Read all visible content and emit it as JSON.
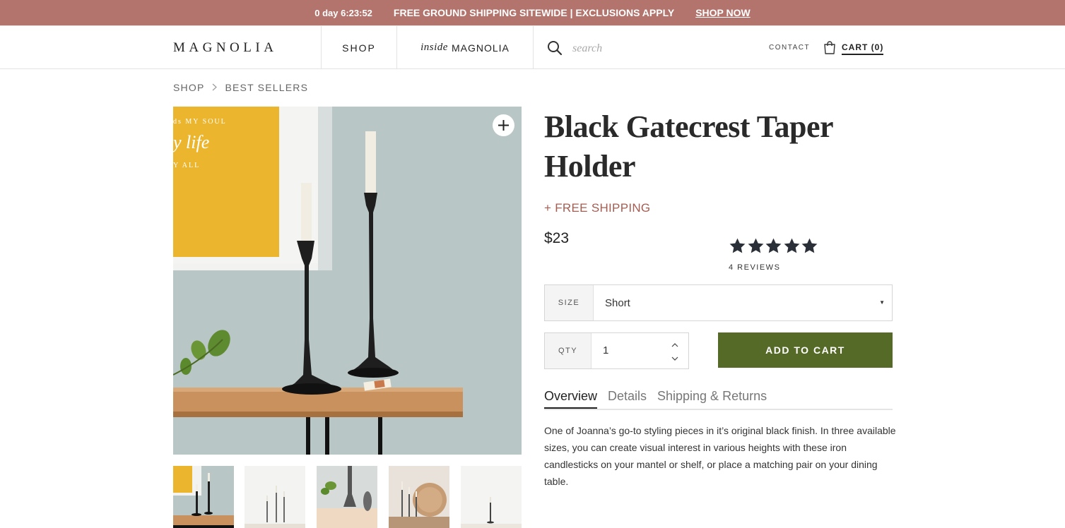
{
  "promo": {
    "timer": "0 day 6:23:52",
    "message": "FREE GROUND SHIPPING SITEWIDE | EXCLUSIONS APPLY",
    "cta": "SHOP NOW",
    "color": "#b2746c"
  },
  "header": {
    "logo": "MAGNOLIA",
    "nav_shop": "SHOP",
    "nav_inside_prefix": "inside",
    "nav_inside_brand": "MAGNOLIA",
    "search_placeholder": "search",
    "contact": "CONTACT",
    "cart": "CART (0)"
  },
  "breadcrumb": [
    "SHOP",
    "BEST SELLERS"
  ],
  "product": {
    "title": "Black Gatecrest Taper Holder",
    "shipping": "+ FREE SHIPPING",
    "price": "$23",
    "rating": 5,
    "reviews": "4 REVIEWS",
    "size_label": "SIZE",
    "size_value": "Short",
    "qty_label": "QTY",
    "qty_value": "1",
    "add_to_cart": "ADD TO CART",
    "add_to_cart_color": "#566a28"
  },
  "tabs": [
    {
      "label": "Overview",
      "active": true
    },
    {
      "label": "Details",
      "active": false
    },
    {
      "label": "Shipping & Returns",
      "active": false
    }
  ],
  "description": "One of Joanna’s go-to styling pieces in it’s original black finish. In three available sizes, you can create visual interest in various heights with these iron candlesticks on your mantel or shelf, or place a matching pair on your dining table.",
  "art_text": {
    "line1": "ds MY SOUL",
    "line2": "y life",
    "line3": "Y ALL"
  }
}
